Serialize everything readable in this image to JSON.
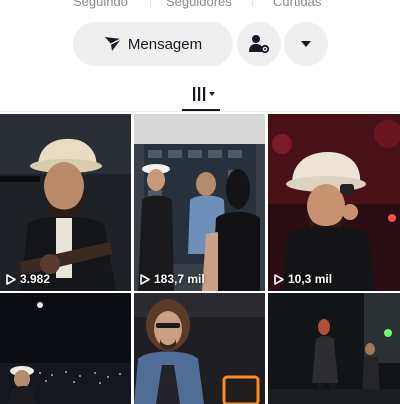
{
  "stats": {
    "following_label": "Seguindo",
    "followers_label": "Seguidores",
    "likes_label": "Curtidas"
  },
  "actions": {
    "message_label": "Mensagem",
    "message_icon": "send-icon",
    "add_friend_icon": "person-settings-icon",
    "more_icon": "chevron-down-icon"
  },
  "tabs": {
    "videos_icon": "grid-icon"
  },
  "videos": [
    {
      "views": "3.982"
    },
    {
      "views": "183,7 mil"
    },
    {
      "views": "10,3 mil"
    },
    {
      "views": ""
    },
    {
      "views": ""
    },
    {
      "views": ""
    }
  ],
  "colors": {
    "button_bg": "#efefef",
    "text": "#161823",
    "muted_text": "#8a8b91"
  }
}
